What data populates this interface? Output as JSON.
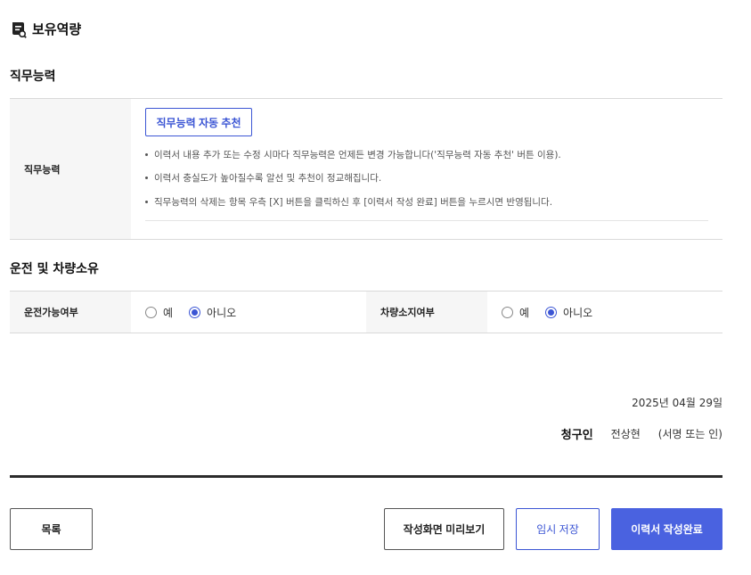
{
  "page": {
    "title": "보유역량",
    "title_icon": "document-icon"
  },
  "job_skills": {
    "section_title": "직무능력",
    "row_label": "직무능력",
    "auto_recommend_button": "직무능력 자동 추천",
    "notes": [
      "이력서 내용 추가 또는 수정 시마다 직무능력은 언제든 변경 가능합니다('직무능력 자동 추천' 버튼 이용).",
      "이력서 충실도가 높아질수록 알선 및 추천이 정교해집니다.",
      "직무능력의 삭제는 항목 우측 [X] 버튼을 클릭하신 후 [이력서 작성 완료] 버튼을 누르시면 반영됩니다."
    ]
  },
  "driving": {
    "section_title": "운전 및 차량소유",
    "can_drive_label": "운전가능여부",
    "owns_vehicle_label": "차량소지여부",
    "yes_label": "예",
    "no_label": "아니오",
    "can_drive_selected": "아니오",
    "owns_vehicle_selected": "아니오"
  },
  "signature": {
    "date": "2025년 04월 29일",
    "claimant_label": "청구인",
    "claimant_name": "전상현",
    "sign_hint": "(서명 또는 인)"
  },
  "buttons": {
    "list": "목록",
    "preview": "작성화면 미리보기",
    "temp_save": "임시 저장",
    "complete": "이력서 작성완료"
  },
  "colors": {
    "accent": "#3b55d4",
    "primary_button": "#4a62e0",
    "header_cell_bg": "#f6f6f6"
  }
}
